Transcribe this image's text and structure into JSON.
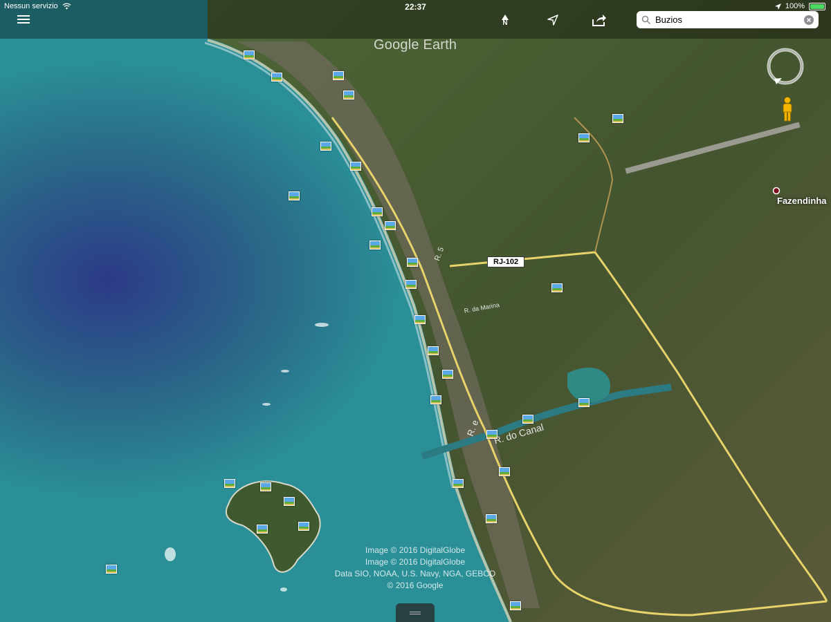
{
  "status_bar": {
    "carrier": "Nessun servizio",
    "time": "22:37",
    "battery_percent": "100%",
    "battery_level": 1.0
  },
  "toolbar": {
    "north_label": "N"
  },
  "search": {
    "value": "Buzios"
  },
  "map": {
    "brand": "Google Earth",
    "road_shield": "RJ-102",
    "place_name": "Fazendinha",
    "street_labels": {
      "canal": "R. do Canal",
      "e": "R. e",
      "r5": "R. 5",
      "marina": "R. da Marina"
    },
    "attribution": {
      "line1": "Image © 2016 DigitalGlobe",
      "line2": "Image © 2016 DigitalGlobe",
      "line3": "Data SIO, NOAA, U.S. Navy, NGA, GEBCO",
      "line4": "© 2016 Google"
    }
  },
  "colors": {
    "ocean_deep": "#2f3f8a",
    "ocean": "#2a8f97",
    "land": "#4b5d33",
    "road": "#e8d36a",
    "battery": "#4cd964"
  },
  "icons": [
    "menu-icon",
    "north-arrow-icon",
    "my-location-icon",
    "share-icon",
    "search-icon",
    "clear-icon",
    "wifi-icon",
    "location-arrow-icon",
    "battery-icon",
    "compass-icon",
    "pegman-icon",
    "photo-icon",
    "place-marker-icon"
  ]
}
